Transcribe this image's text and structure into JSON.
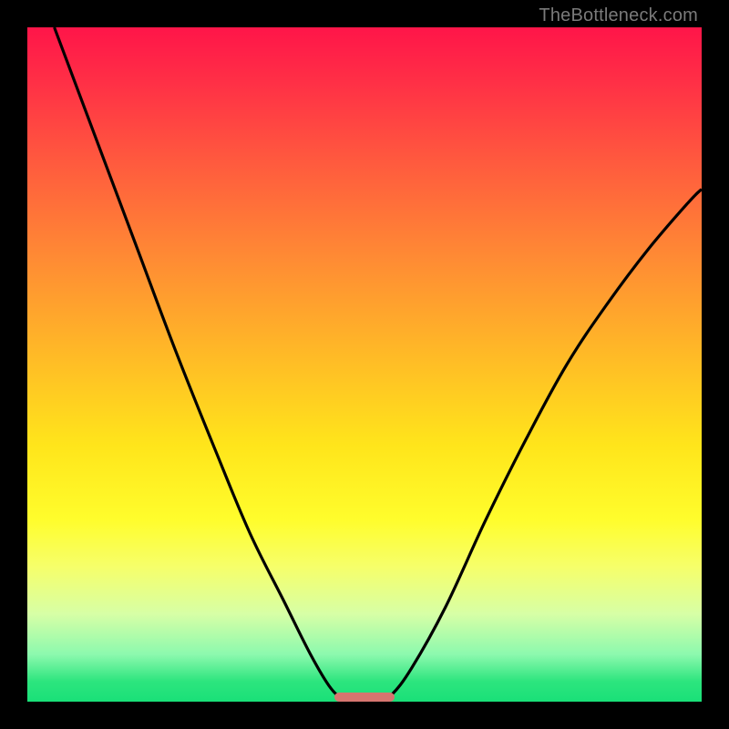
{
  "watermark": "TheBottleneck.com",
  "colors": {
    "frame": "#000000",
    "curve": "#000000",
    "bar": "#d7756f",
    "gradient_top": "#ff1549",
    "gradient_bottom": "#19e078"
  },
  "chart_data": {
    "type": "line",
    "title": "",
    "xlabel": "",
    "ylabel": "",
    "xlim": [
      0,
      1
    ],
    "ylim": [
      0,
      1
    ],
    "note": "No axis ticks or numeric labels visible; values are normalized from pixel geometry of the two curves. y=0 is the bottom edge, y=1 is the top.",
    "series": [
      {
        "name": "left-curve",
        "x": [
          0.04,
          0.1,
          0.16,
          0.22,
          0.28,
          0.33,
          0.38,
          0.42,
          0.45,
          0.47,
          0.48
        ],
        "y": [
          1.0,
          0.84,
          0.68,
          0.52,
          0.37,
          0.25,
          0.15,
          0.07,
          0.02,
          0.003,
          0.0
        ]
      },
      {
        "name": "right-curve",
        "x": [
          0.52,
          0.54,
          0.57,
          0.62,
          0.68,
          0.74,
          0.8,
          0.86,
          0.92,
          0.98,
          1.0
        ],
        "y": [
          0.0,
          0.01,
          0.05,
          0.14,
          0.27,
          0.39,
          0.5,
          0.59,
          0.67,
          0.74,
          0.76
        ]
      }
    ],
    "marker": {
      "name": "bottom-bar",
      "x_range": [
        0.455,
        0.545
      ],
      "y": 0.0
    }
  }
}
